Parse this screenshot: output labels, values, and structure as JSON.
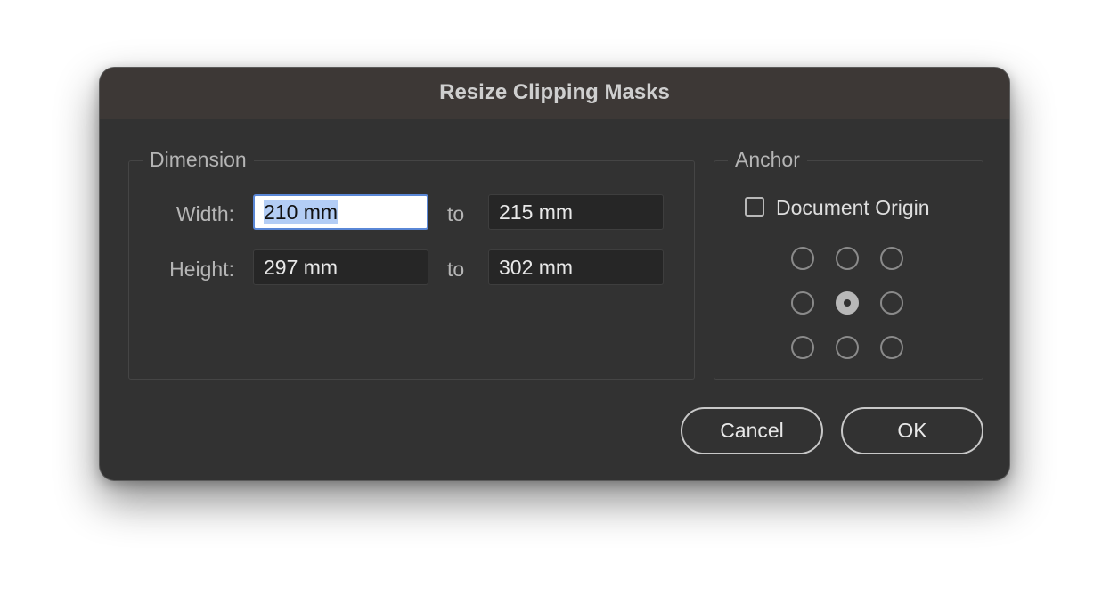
{
  "dialog": {
    "title": "Resize Clipping Masks"
  },
  "dimension": {
    "label": "Dimension",
    "width": {
      "label": "Width:",
      "from_value": "210 mm",
      "to_label": "to",
      "to_value": "215 mm"
    },
    "height": {
      "label": "Height:",
      "from_value": "297 mm",
      "to_label": "to",
      "to_value": "302 mm"
    }
  },
  "anchor": {
    "label": "Anchor",
    "document_origin_label": "Document Origin",
    "document_origin_checked": false,
    "selected_point": "center"
  },
  "buttons": {
    "cancel": "Cancel",
    "ok": "OK"
  },
  "colors": {
    "dialog_bg": "#323232",
    "titlebar_bg": "#3d3836",
    "focus_ring": "#5a87d6",
    "selection": "#b3cdf5"
  }
}
